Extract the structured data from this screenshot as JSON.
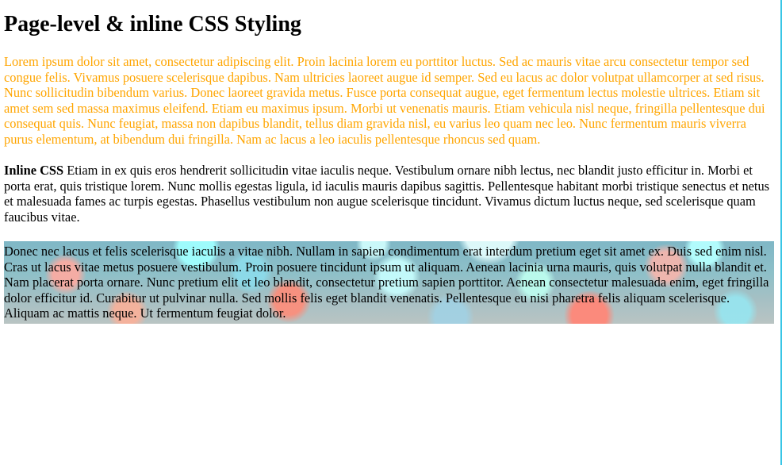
{
  "page": {
    "title": "Page-level & inline CSS Styling"
  },
  "paragraphs": {
    "orange": "Lorem ipsum dolor sit amet, consectetur adipiscing elit. Proin lacinia lorem eu porttitor luctus. Sed ac mauris vitae arcu consectetur tempor sed congue felis. Vivamus posuere scelerisque dapibus. Nam ultricies laoreet augue id semper. Sed eu lacus ac dolor volutpat ullamcorper at sed risus. Nunc sollicitudin bibendum varius. Donec laoreet gravida metus. Fusce porta consequat augue, eget fermentum lectus molestie ultrices. Etiam sit amet sem sed massa maximus eleifend. Etiam eu maximus ipsum. Morbi ut venenatis mauris. Etiam vehicula nisl neque, fringilla pellentesque dui consequat quis. Nunc feugiat, massa non dapibus blandit, tellus diam gravida nisl, eu varius leo quam nec leo. Nunc fermentum mauris viverra purus elementum, at bibendum dui fringilla. Nam ac lacus a leo iaculis pellentesque rhoncus sed quam.",
    "inline_label": "Inline CSS",
    "inline_text": " Etiam in ex quis eros hendrerit sollicitudin vitae iaculis neque. Vestibulum ornare nibh lectus, nec blandit justo efficitur in. Morbi et porta erat, quis tristique lorem. Nunc mollis egestas ligula, id iaculis mauris dapibus sagittis. Pellentesque habitant morbi tristique senectus et netus et malesuada fames ac turpis egestas. Phasellus vestibulum non augue scelerisque tincidunt. Vivamus dictum luctus neque, sed scelerisque quam faucibus vitae.",
    "bokeh": "Donec nec lacus et felis scelerisque iaculis a vitae nibh. Nullam in sapien condimentum erat interdum pretium eget sit amet ex. Duis sed enim nisl. Cras ut lacus vitae metus posuere vestibulum. Proin posuere tincidunt ipsum ut aliquam. Aenean lacinia urna mauris, quis volutpat nulla blandit et. Nam placerat porta ornare. Nunc pretium elit et leo blandit, consectetur pretium sapien porttitor. Aenean consectetur malesuada enim, eget fringilla dolor efficitur id. Curabitur ut pulvinar nulla. Sed mollis felis eget blandit venenatis. Pellentesque eu nisi pharetra felis aliquam scelerisque. Aliquam ac mattis neque. Ut fermentum feugiat dolor."
  },
  "colors": {
    "orange_text": "#ffa500",
    "body_text": "#000000",
    "page_background": "#ffffff",
    "edge_accent": "#39c6e6"
  }
}
